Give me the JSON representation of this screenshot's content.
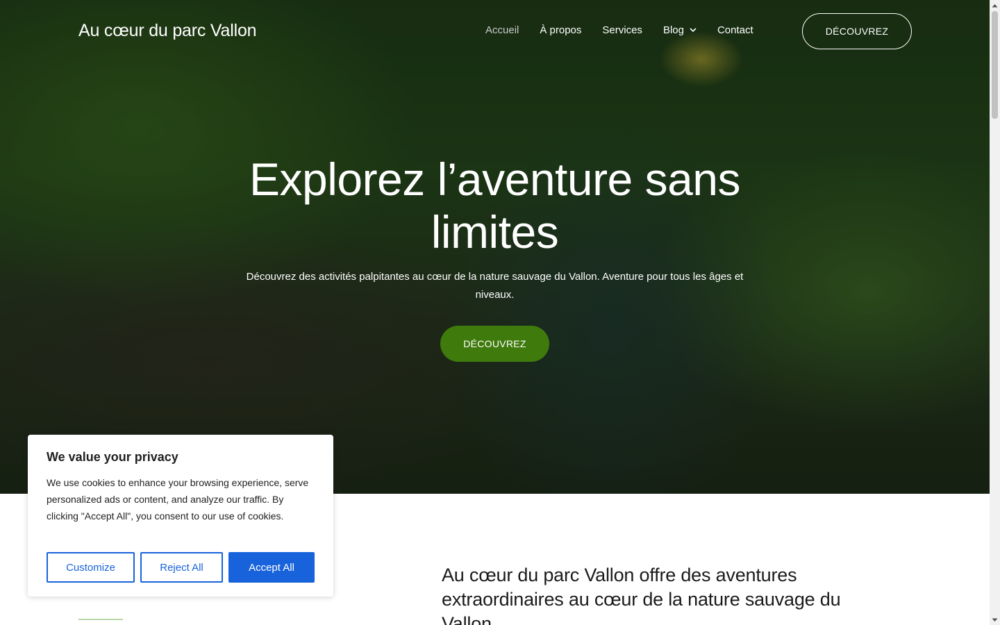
{
  "header": {
    "site_title": "Au cœur du parc Vallon",
    "nav": [
      {
        "label": "Accueil"
      },
      {
        "label": "À propos"
      },
      {
        "label": "Services"
      },
      {
        "label": "Blog"
      },
      {
        "label": "Contact"
      }
    ],
    "cta_label": "DÉCOUVREZ"
  },
  "hero": {
    "title": "Explorez l’aventure sans limites",
    "subtitle": "Découvrez des activités palpitantes au cœur de la nature sauvage du Vallon. Aventure pour tous les âges et niveaux.",
    "button_label": "DÉCOUVREZ"
  },
  "section": {
    "heading": "Au cœur du parc Vallon offre des aventures extraordinaires au cœur de la nature sauvage du Vallon"
  },
  "cookie": {
    "title": "We value your privacy",
    "text": "We use cookies to enhance your browsing experience, serve personalized ads or content, and analyze our traffic. By clicking \"Accept All\", you consent to our use of cookies.",
    "customize_label": "Customize",
    "reject_label": "Reject All",
    "accept_label": "Accept All"
  },
  "colors": {
    "accent_green": "#3f7a0c",
    "cookie_blue": "#1863dc"
  },
  "icons": {
    "blog_dropdown": "chevron-down-icon",
    "scroll_up": "scroll-up-arrow-icon",
    "scroll_down": "scroll-down-arrow-icon"
  }
}
